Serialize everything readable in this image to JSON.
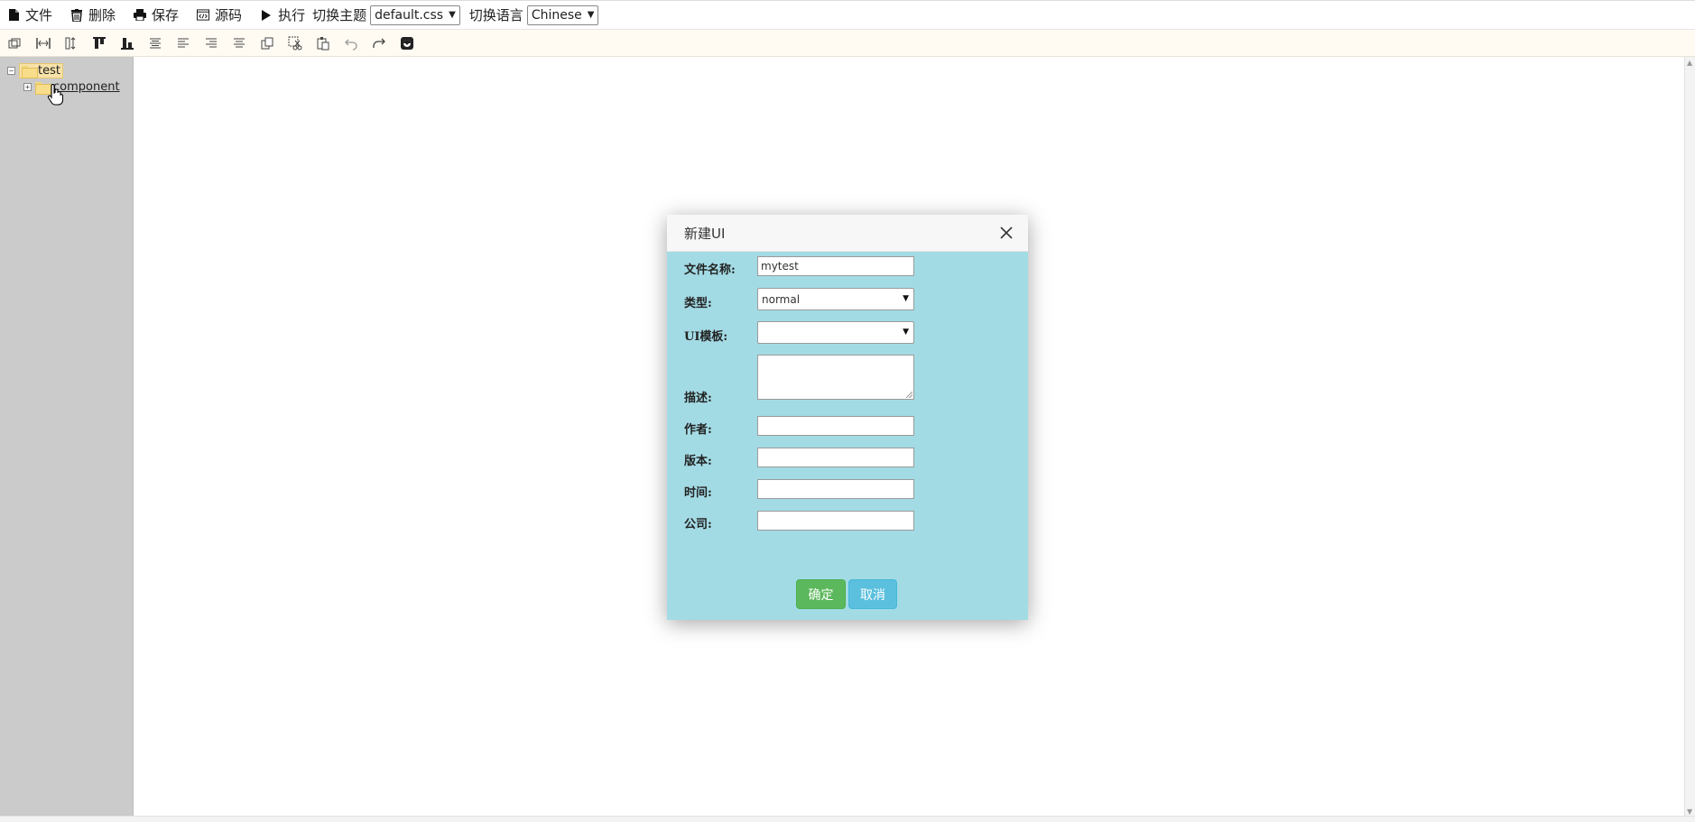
{
  "menubar": {
    "items": [
      {
        "label": "文件",
        "icon": "file-icon"
      },
      {
        "label": "删除",
        "icon": "trash-icon"
      },
      {
        "label": "保存",
        "icon": "printer-icon"
      },
      {
        "label": "源码",
        "icon": "code-icon"
      },
      {
        "label": "执行",
        "icon": "play-icon"
      }
    ],
    "theme_label": "切换主题",
    "theme_value": "default.css",
    "language_label": "切换语言",
    "language_value": "Chinese"
  },
  "toolbar": {
    "buttons": [
      "same-size-icon",
      "same-width-icon",
      "same-height-icon",
      "align-top-icon",
      "align-bottom-icon",
      "align-middle-icon",
      "align-left-icon",
      "align-right-icon",
      "align-center-icon",
      "copy-icon",
      "cut-icon",
      "paste-icon",
      "undo-icon",
      "redo-icon",
      "preview-icon"
    ]
  },
  "tree": {
    "root": {
      "label": "test",
      "expander": "⊟"
    },
    "child": {
      "label": "component",
      "expander": "⊞"
    }
  },
  "dialog": {
    "title": "新建UI",
    "fields": {
      "filename_label": "文件名称:",
      "filename_value": "mytest",
      "type_label": "类型:",
      "type_value": "normal",
      "template_label": "UI模板:",
      "template_value": "",
      "description_label": "描述:",
      "author_label": "作者:",
      "version_label": "版本:",
      "time_label": "时间:",
      "company_label": "公司:"
    },
    "ok_label": "确定",
    "cancel_label": "取消"
  },
  "colors": {
    "dialog_body": "#a3dbe5",
    "ok_button": "#5cb85c",
    "cancel_button": "#5bc0de",
    "sidebar": "#cbcbcb",
    "toolbar": "#fffbf3"
  }
}
